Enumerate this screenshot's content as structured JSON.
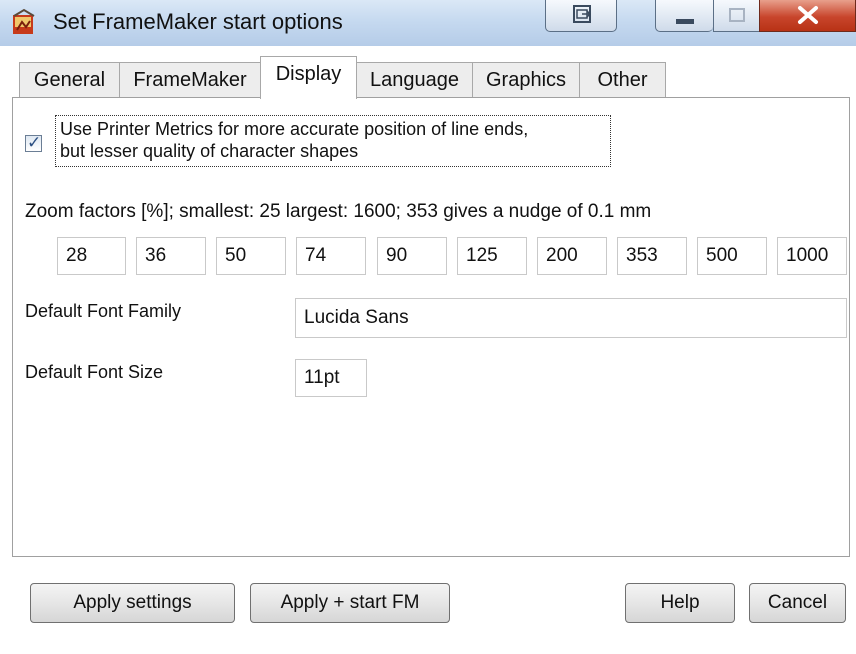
{
  "window": {
    "title": "Set FrameMaker start options",
    "icon": "framemaker-app-icon"
  },
  "tabs": [
    {
      "label": "General"
    },
    {
      "label": "FrameMaker"
    },
    {
      "label": "Display",
      "active": true
    },
    {
      "label": "Language"
    },
    {
      "label": "Graphics"
    },
    {
      "label": "Other"
    }
  ],
  "display": {
    "printer_metrics": {
      "checked": true,
      "line1": "Use Printer Metrics for more accurate position of line ends,",
      "line2": "but lesser quality of character shapes"
    },
    "zoom_caption": "Zoom factors [%]; smallest: 25 largest: 1600; 353 gives a nudge of 0.1 mm",
    "zoom_values": [
      "28",
      "36",
      "50",
      "74",
      "90",
      "125",
      "200",
      "353",
      "500",
      "1000"
    ],
    "font_family_label": "Default Font Family",
    "font_family_value": "Lucida Sans",
    "font_size_label": "Default Font Size",
    "font_size_value": "11pt"
  },
  "buttons": {
    "apply_settings": "Apply settings",
    "apply_start": "Apply + start FM",
    "help": "Help",
    "cancel": "Cancel"
  }
}
